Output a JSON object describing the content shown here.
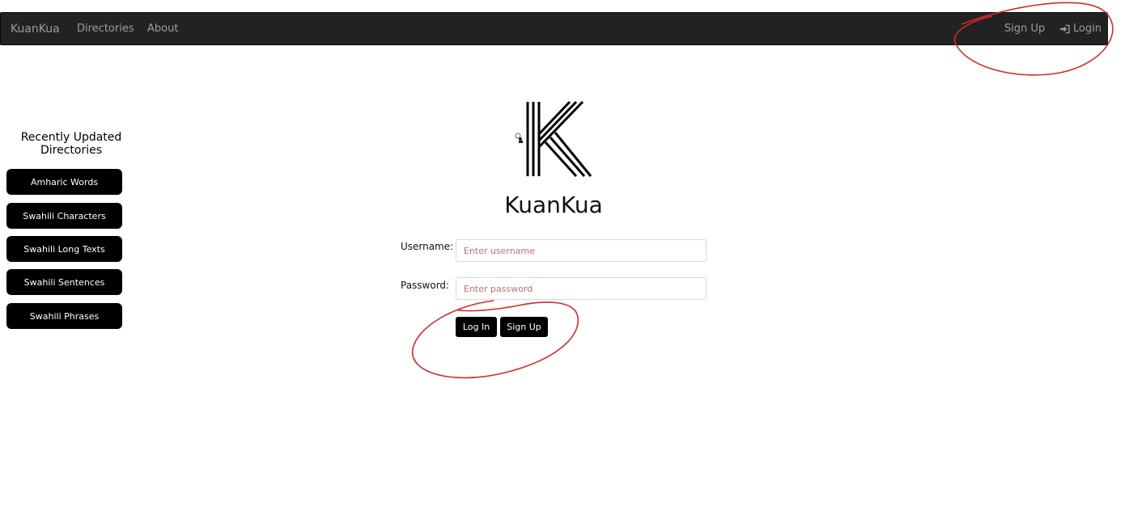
{
  "navbar": {
    "brand": "KuanKua",
    "links": {
      "directories": "Directories",
      "about": "About"
    },
    "right": {
      "signup": "Sign Up",
      "login": "Login"
    }
  },
  "sidebar": {
    "title": "Recently Updated Directories",
    "items": [
      {
        "label": "Amharic Words"
      },
      {
        "label": "Swahili Characters"
      },
      {
        "label": "Swahili Long Texts"
      },
      {
        "label": "Swahili Sentences"
      },
      {
        "label": "Swahili Phrases"
      }
    ]
  },
  "main": {
    "title": "KuanKua",
    "logo_letter": "K",
    "form": {
      "username_label": "Username:",
      "username_placeholder": "Enter username",
      "username_value": "",
      "password_label": "Password:",
      "password_placeholder": "Enter password",
      "password_value": "",
      "login_button": "Log In",
      "signup_button": "Sign Up"
    }
  },
  "colors": {
    "navbar_bg": "#222222",
    "nav_text": "#9d9d9d",
    "button_bg": "#000000",
    "annotation": "#d42a2a",
    "placeholder": "#c07070"
  },
  "icons": {
    "login": "sign-in-icon",
    "logo": "k-logo-icon",
    "cursor": "cursor-icon"
  }
}
